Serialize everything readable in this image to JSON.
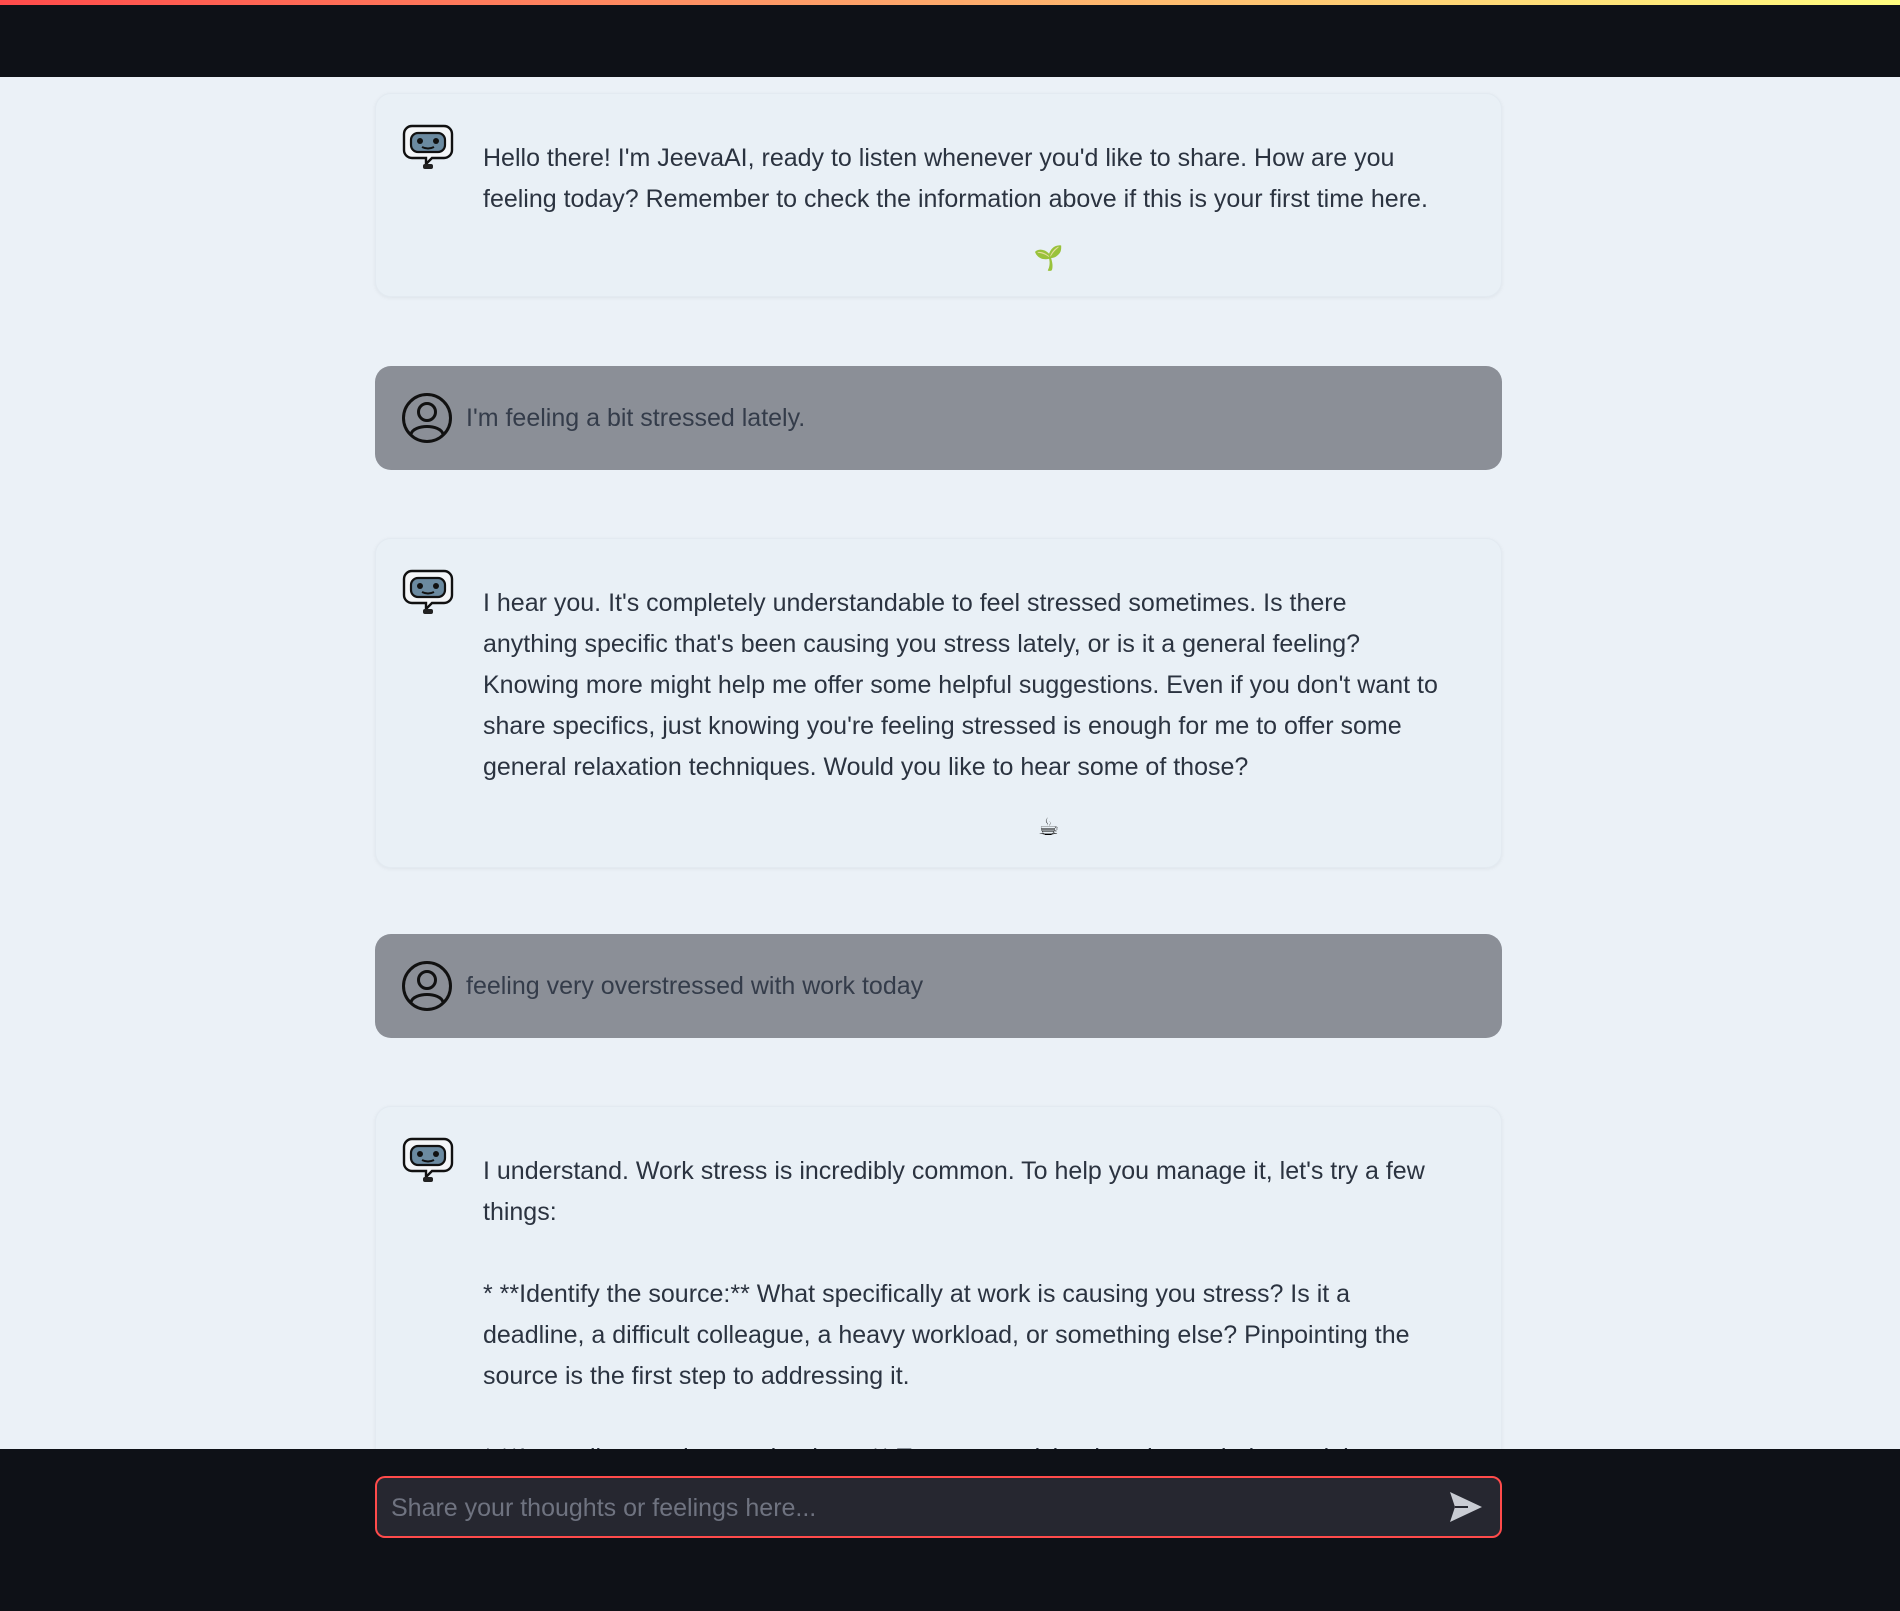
{
  "header": {
    "accent_colors": [
      "#ff4b4b",
      "#fda169",
      "#fffd80"
    ],
    "background": "#0e1117"
  },
  "chat": {
    "messages": [
      {
        "role": "assistant",
        "avatar_icon": "robot-speech-bubble-icon",
        "text": "Hello there! I'm JeevaAI, ready to listen whenever you'd like to share. How are you feeling today? Remember to check the information above if this is your first time here.",
        "emoji": "🌱"
      },
      {
        "role": "user",
        "avatar_icon": "user-circle-icon",
        "text": "I'm feeling a bit stressed lately."
      },
      {
        "role": "assistant",
        "avatar_icon": "robot-speech-bubble-icon",
        "text": "I hear you. It's completely understandable to feel stressed sometimes. Is there anything specific that's been causing you stress lately, or is it a general feeling? Knowing more might help me offer some helpful suggestions. Even if you don't want to share specifics, just knowing you're feeling stressed is enough for me to offer some general relaxation techniques. Would you like to hear some of those?",
        "emoji": "☕"
      },
      {
        "role": "user",
        "avatar_icon": "user-circle-icon",
        "text": "feeling very overstressed with work today"
      },
      {
        "role": "assistant",
        "avatar_icon": "robot-speech-bubble-icon",
        "text": "I understand. Work stress is incredibly common. To help you manage it, let's try a few things:\n\n* **Identify the source:** What specifically at work is causing you stress? Is it a deadline, a difficult colleague, a heavy workload, or something else? Pinpointing the source is the first step to addressing it.\n\n* **Immediate coping mechanisms:** Try some quick relaxation techniques right now. Deep"
      }
    ]
  },
  "input": {
    "placeholder": "Share your thoughts or feelings here...",
    "value": "",
    "border_color": "#ff4b4b",
    "send_icon": "send-arrow-icon"
  }
}
